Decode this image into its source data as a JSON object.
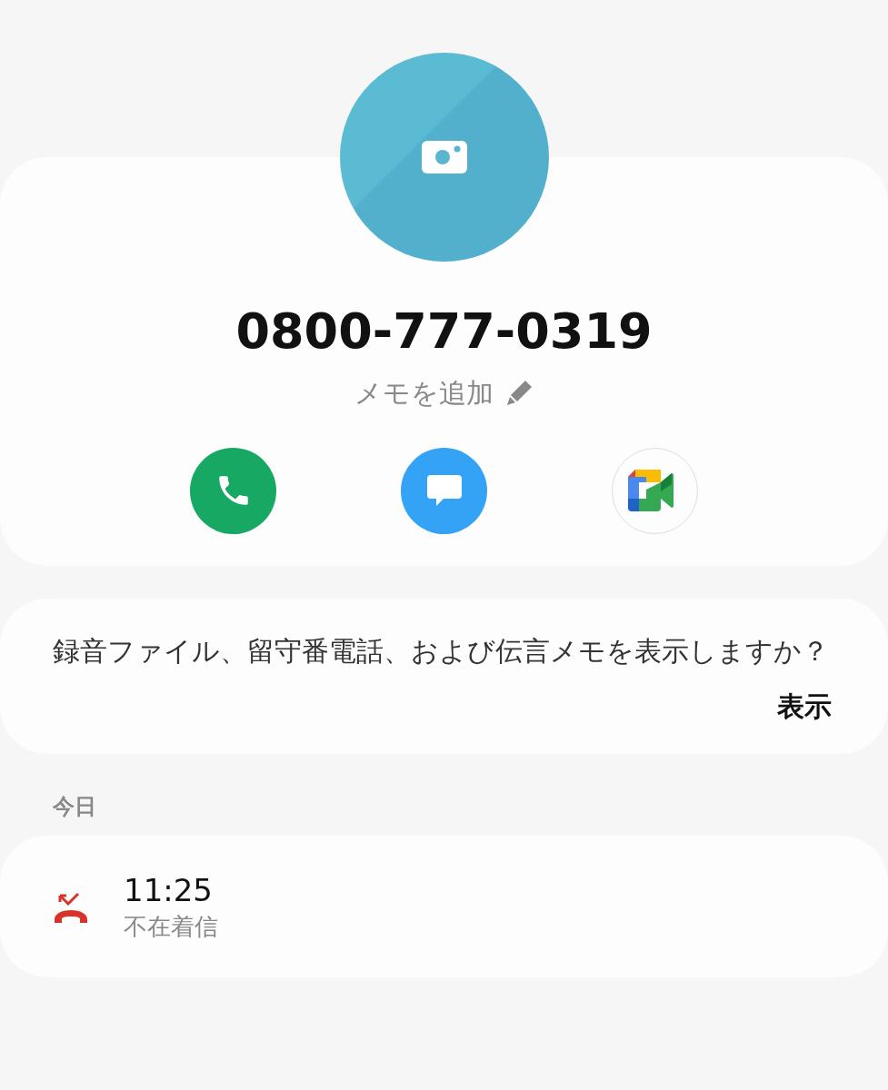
{
  "contact": {
    "number": "0800-777-0319",
    "memo_label": "メモを追加"
  },
  "actions": [
    {
      "kind": "call"
    },
    {
      "kind": "message"
    },
    {
      "kind": "video"
    }
  ],
  "prompt": {
    "text": "録音ファイル、留守番電話、および伝言メモを表示しますか？",
    "button": "表示"
  },
  "history": {
    "header": "今日",
    "calls": [
      {
        "kind": "missed",
        "time": "11:25",
        "label": "不在着信"
      }
    ]
  }
}
